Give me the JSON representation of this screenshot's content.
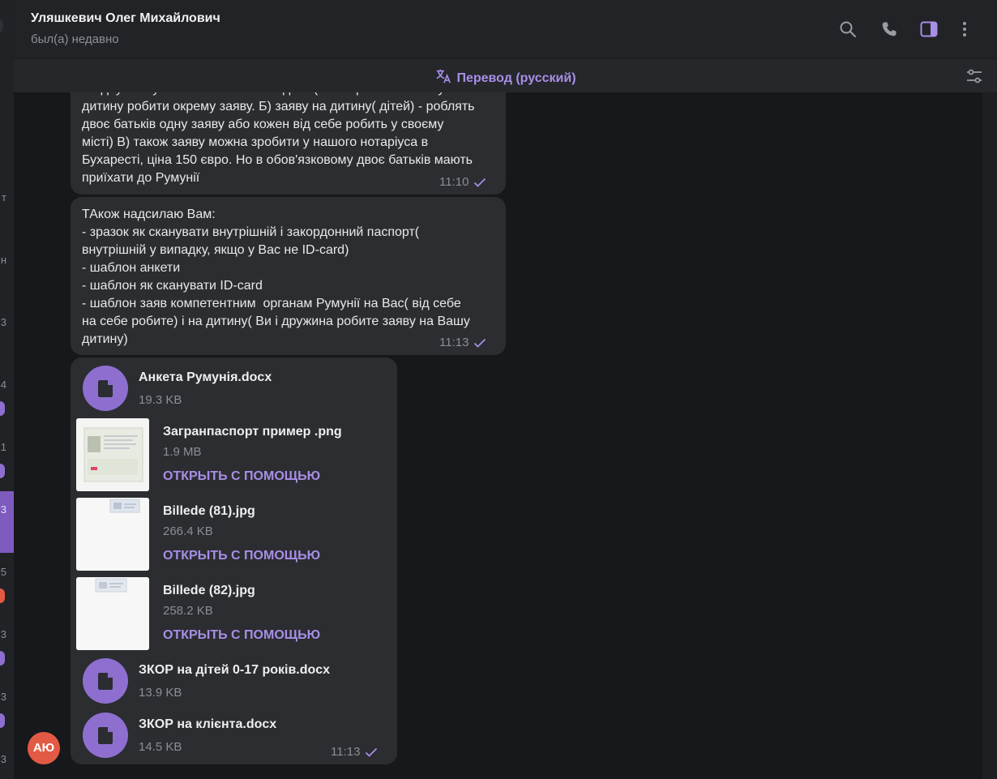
{
  "chat": {
    "contact_name": "Уляшкевич Олег Михайлович",
    "contact_status": "был(а) недавно"
  },
  "translate_bar": {
    "label": "Перевод (русский)"
  },
  "left_strip": {
    "fragments": [
      "т",
      "н",
      "3",
      "4",
      "1",
      "3",
      "5",
      "3",
      "3",
      "3"
    ]
  },
  "messages": [
    {
      "text": "В одну заяву можна вписати всіх дітей(не потрібно на кожну\nдитину робити окрему заяву. Б) заяву на дитину( дітей) - роблять\nдвоє батьків одну заяву або кожен від себе робить у своєму\nмісті) В) також заяву можна зробити у нашого нотаріуса в\nБухаресті, ціна 150 євро. Но в обов'язковому двоє батьків мають\nприїхати до Румунії",
      "time": "11:10"
    },
    {
      "text": "ТАкож надсилаю Вам:\n- зразок як сканувати внутрішній і закордонний паспорт(\nвнутрішній у випадку, якщо у Вас не ID-card)\n- шаблон анкети\n- шаблон як сканувати ID-card\n- шаблон заяв компетентним  органам Румунії на Вас( від себе\nна себе робите) і на дитину( Ви і дружина робите заяву на Вашу\nдитину)",
      "time": "11:13"
    }
  ],
  "files": {
    "time": "11:13",
    "open_with_label": "ОТКРЫТЬ С ПОМОЩЬЮ",
    "items": [
      {
        "name": "Анкета Румунія.docx",
        "size": "19.3 KB",
        "kind": "document"
      },
      {
        "name": "Загранпаспорт пример .png",
        "size": "1.9 MB",
        "kind": "image"
      },
      {
        "name": "Billede (81).jpg",
        "size": "266.4 KB",
        "kind": "image"
      },
      {
        "name": "Billede (82).jpg",
        "size": "258.2 KB",
        "kind": "image"
      },
      {
        "name": "ЗКОР на дітей 0-17 років.docx",
        "size": "13.9 KB",
        "kind": "document"
      },
      {
        "name": "ЗКОР на клієнта.docx",
        "size": "14.5 KB",
        "kind": "document"
      }
    ]
  },
  "sender_avatar": {
    "initials": "АЮ",
    "color": "#e35a44"
  },
  "colors": {
    "accent": "#a88ee6",
    "file_icon": "#8e6fcf",
    "bubble": "#2b2d31"
  }
}
